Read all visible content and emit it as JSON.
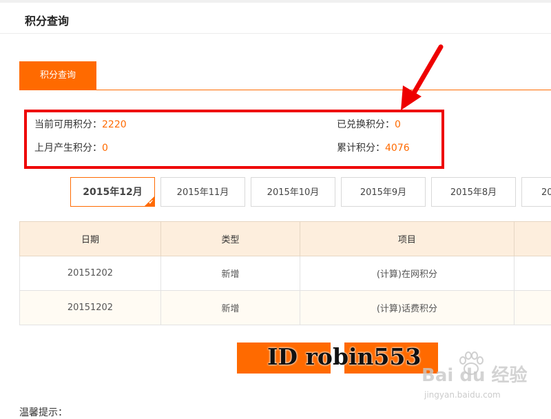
{
  "header": {
    "title": "积分查询"
  },
  "tabs": [
    {
      "label": "积分查询",
      "active": true
    }
  ],
  "summary": {
    "available_label": "当前可用积分：",
    "available_value": "2220",
    "redeemed_label": "已兑换积分：",
    "redeemed_value": "0",
    "last_month_label": "上月产生积分：",
    "last_month_value": "0",
    "total_label": "累计积分：",
    "total_value": "4076"
  },
  "months": [
    {
      "label": "2015年12月",
      "active": true
    },
    {
      "label": "2015年11月"
    },
    {
      "label": "2015年10月"
    },
    {
      "label": "2015年9月"
    },
    {
      "label": "2015年8月"
    },
    {
      "label": "20"
    }
  ],
  "table": {
    "columns": [
      "日期",
      "类型",
      "项目",
      ""
    ],
    "rows": [
      {
        "date": "20151202",
        "type": "新增",
        "item": "(计算)在网积分",
        "extra": ""
      },
      {
        "date": "20151202",
        "type": "新增",
        "item": "(计算)话费积分",
        "extra": ""
      }
    ]
  },
  "buttons": {
    "left_label": "",
    "right_label": ""
  },
  "watermark": {
    "text": "ID robin553",
    "baidu": "Bai du 经验",
    "baidu_sub": "jingyan.baidu.com"
  },
  "tips": {
    "label": "温馨提示："
  },
  "colors": {
    "accent": "#ff6a00",
    "highlight_box": "#ee0000",
    "table_header_bg": "#fdeedd"
  }
}
